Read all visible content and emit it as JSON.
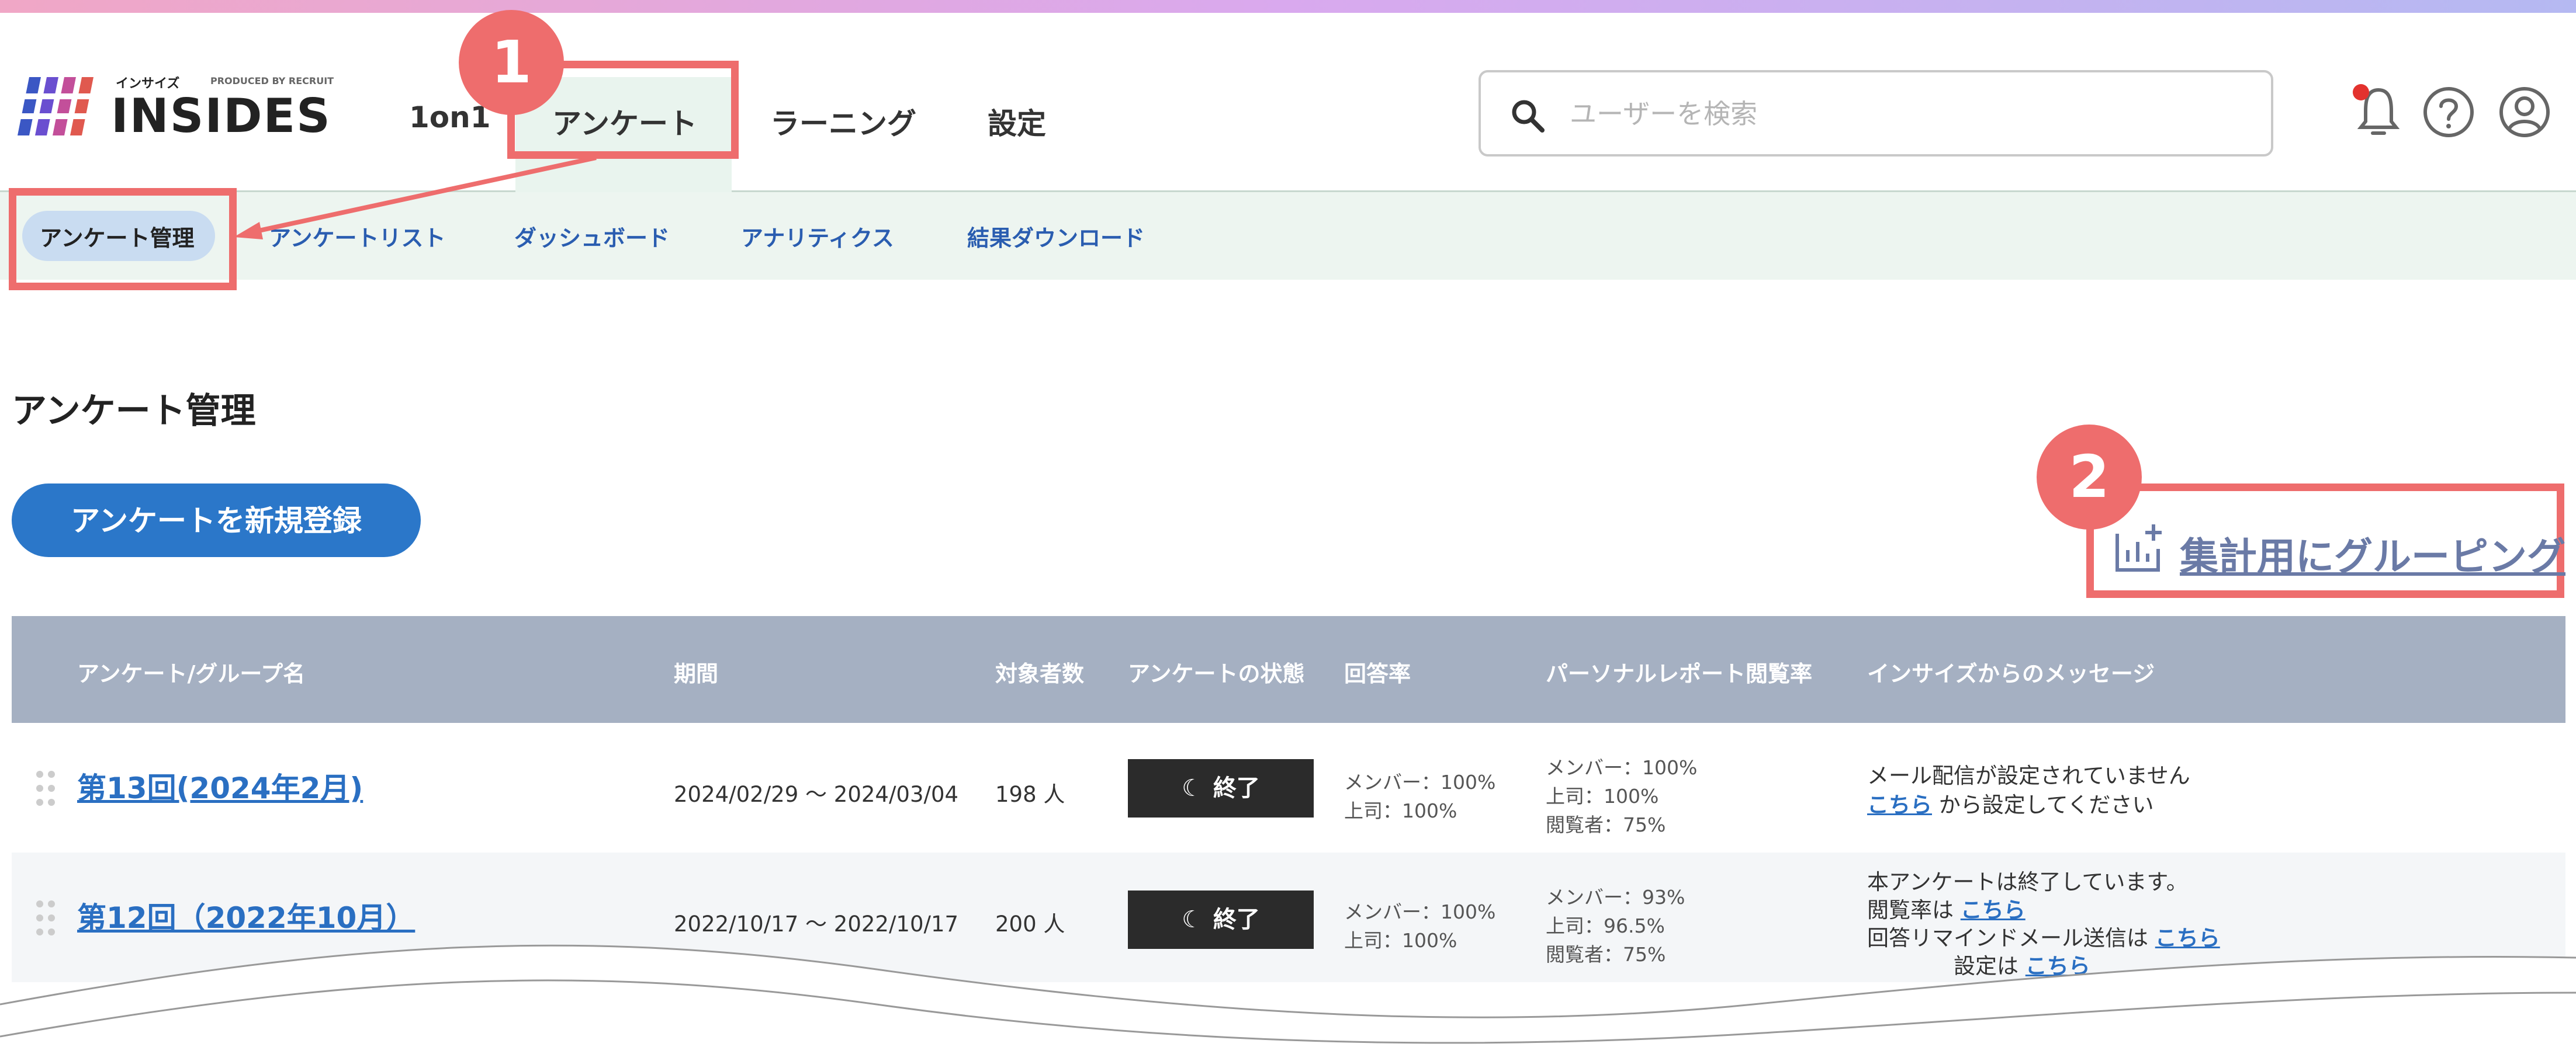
{
  "header": {
    "logo_small": "インサイズ",
    "logo_small_sub": "PRODUCED BY RECRUIT",
    "logo_text": "INSIDES",
    "nav": [
      "1on1",
      "アンケート",
      "ラーニング",
      "設定"
    ],
    "search_placeholder": "ユーザーを検索"
  },
  "subnav": [
    "アンケート管理",
    "アンケートリスト",
    "ダッシュボード",
    "アナリティクス",
    "結果ダウンロード"
  ],
  "annotations": {
    "one": "1",
    "two": "2"
  },
  "main": {
    "page_title": "アンケート管理",
    "new_button": "アンケートを新規登録",
    "group_link": "集計用にグルーピング"
  },
  "table": {
    "headers": [
      "アンケート/グループ名",
      "期間",
      "対象者数",
      "アンケートの状態",
      "回答率",
      "パーソナルレポート閲覧率",
      "インサイズからのメッセージ"
    ],
    "rows": [
      {
        "title": "第13回(2024年2月)",
        "period": "2024/02/29 ～ 2024/03/04",
        "count": "198 人",
        "status": "終了",
        "answer": [
          "メンバー：100%",
          "上司：100%"
        ],
        "report": [
          "メンバー：100%",
          "上司：100%",
          "閲覧者：75%"
        ],
        "message": {
          "line1": "メール配信が設定されていません",
          "link": "こちら",
          "line2": " から設定してください"
        }
      },
      {
        "title": "第12回（2022年10月）",
        "period": "2022/10/17 ～ 2022/10/17",
        "count": "200 人",
        "status": "終了",
        "answer": [
          "メンバー：100%",
          "上司：100%"
        ],
        "report": [
          "メンバー：93%",
          "上司：96.5%",
          "閲覧者：75%"
        ],
        "message": {
          "line1": "本アンケートは終了しています。",
          "line2_prefix": "閲覧率は ",
          "line2_link": "こちら",
          "line3_prefix": "回答リマインドメール送信は ",
          "line3_link": "こちら",
          "line4_prefix": "　　　　設定は ",
          "line4_link": "こちら"
        }
      }
    ]
  }
}
